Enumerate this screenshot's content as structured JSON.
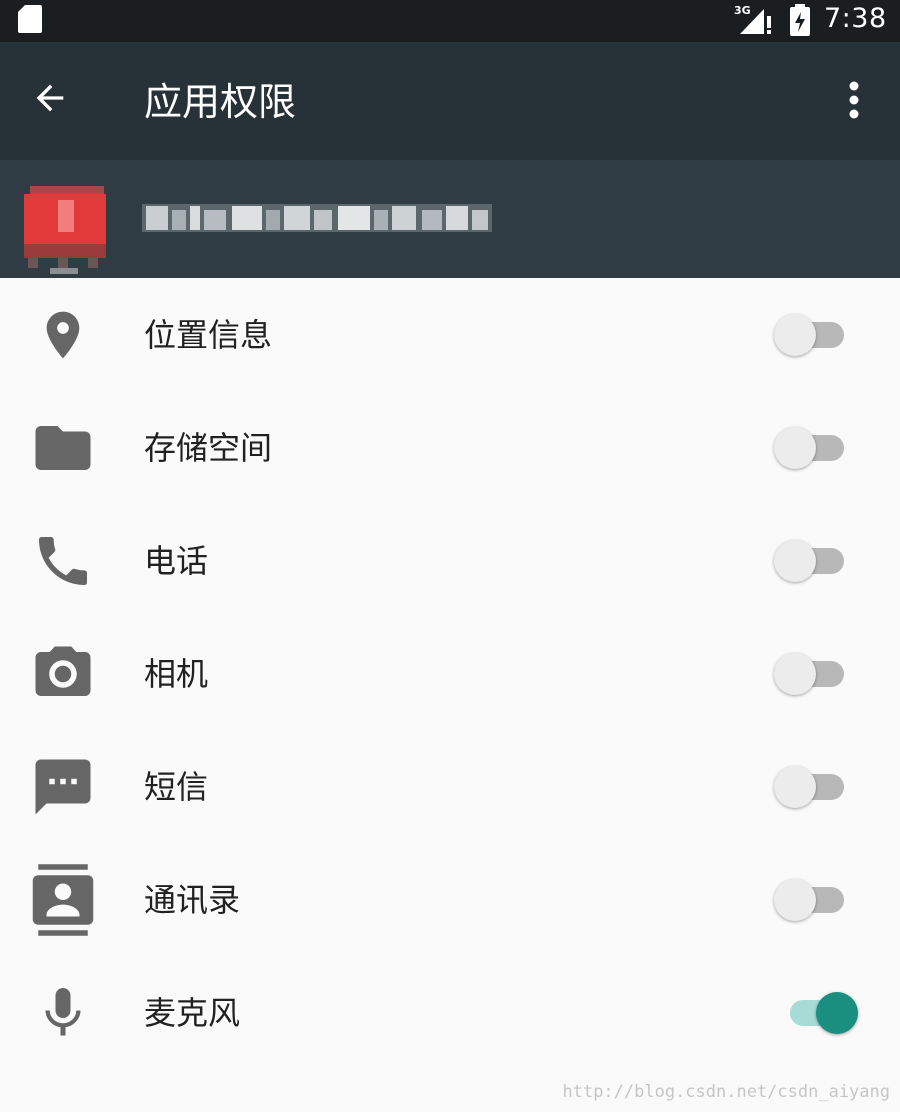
{
  "status_bar": {
    "network_type": "3G",
    "time": "7:38",
    "icons": [
      "sd-card-icon",
      "signal-icon",
      "battery-icon"
    ]
  },
  "toolbar": {
    "back_icon": "arrow-back-icon",
    "title": "应用权限",
    "overflow_icon": "more-vert-icon"
  },
  "app_header": {
    "app_icon": "app-icon"
  },
  "permissions": [
    {
      "label": "位置信息",
      "icon": "location-pin-icon",
      "enabled": false
    },
    {
      "label": "存储空间",
      "icon": "folder-icon",
      "enabled": false
    },
    {
      "label": "电话",
      "icon": "phone-icon",
      "enabled": false
    },
    {
      "label": "相机",
      "icon": "camera-icon",
      "enabled": false
    },
    {
      "label": "短信",
      "icon": "sms-icon",
      "enabled": false
    },
    {
      "label": "通讯录",
      "icon": "contacts-icon",
      "enabled": false
    },
    {
      "label": "麦克风",
      "icon": "microphone-icon",
      "enabled": true
    }
  ],
  "watermark": "http://blog.csdn.net/csdn_aiyang",
  "colors": {
    "status_bar": "#1a1e21",
    "toolbar": "#263238",
    "app_header": "#2f3c43",
    "background": "#fafafa",
    "icon_gray": "#666666",
    "switch_on": "#1a8f80",
    "switch_on_track": "#a7dbd6",
    "switch_off_thumb": "#ececec",
    "switch_off_track": "#b8b8b8"
  }
}
